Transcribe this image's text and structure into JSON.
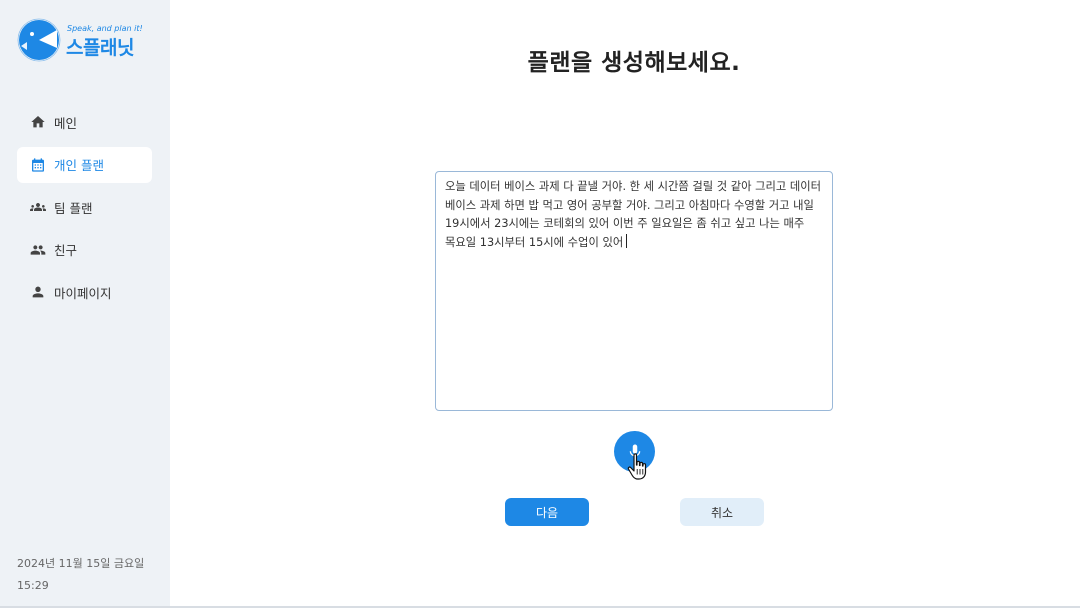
{
  "brand": {
    "tagline": "Speak, and plan it!",
    "name": "스플래닛",
    "color": "#1e88e5"
  },
  "sidebar": {
    "items": [
      {
        "label": "메인",
        "icon": "home-icon",
        "active": false
      },
      {
        "label": "개인 플랜",
        "icon": "calendar-icon",
        "active": true
      },
      {
        "label": "팀 플랜",
        "icon": "group-icon",
        "active": false
      },
      {
        "label": "친구",
        "icon": "people-icon",
        "active": false
      },
      {
        "label": "마이페이지",
        "icon": "person-icon",
        "active": false
      }
    ],
    "date": "2024년 11월 15일 금요일",
    "time": "15:29"
  },
  "main": {
    "title": "플랜을 생성해보세요.",
    "input_text": "오늘 데이터 베이스 과제 다 끝낼 거야. 한 세 시간쯤 걸릴 것 같아 그리고 데이터 베이스 과제 하면 밥 먹고 영어 공부할 거야. 그리고 아침마다 수영할 거고 내일 19시에서 23시에는 코테회의 있어 이번 주 일요일은 좀 쉬고 싶고 나는 매주 목요일 13시부터 15시에 수업이 있어",
    "mic_icon": "microphone-icon",
    "next_label": "다음",
    "cancel_label": "취소"
  }
}
